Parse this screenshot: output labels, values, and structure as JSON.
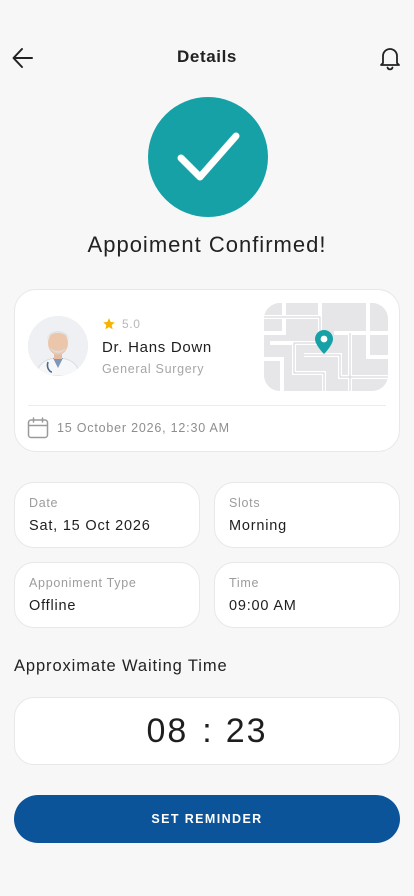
{
  "header": {
    "title": "Details",
    "back_icon": "arrow-left-icon",
    "notification_icon": "bell-icon"
  },
  "confirmation": {
    "icon": "checkmark-icon",
    "title": "Appoiment Confirmed!"
  },
  "doctor": {
    "rating": "5.0",
    "name": "Dr. Hans Down",
    "specialty": "General Surgery",
    "appointment_datetime": "15 October 2026, 12:30 AM"
  },
  "details": {
    "date": {
      "label": "Date",
      "value": "Sat, 15 Oct 2026"
    },
    "slots": {
      "label": "Slots",
      "value": "Morning"
    },
    "type": {
      "label": "Apponiment Type",
      "value": "Offline"
    },
    "time": {
      "label": "Time",
      "value": "09:00 AM"
    }
  },
  "waiting": {
    "title": "Approximate Waiting Time",
    "minutes": "08",
    "separator": ":",
    "seconds": "23"
  },
  "actions": {
    "set_reminder": "SET REMINDER"
  },
  "colors": {
    "teal": "#16a1a7",
    "primary": "#0b5499",
    "star": "#f5b400",
    "background": "#f7f7f8"
  }
}
